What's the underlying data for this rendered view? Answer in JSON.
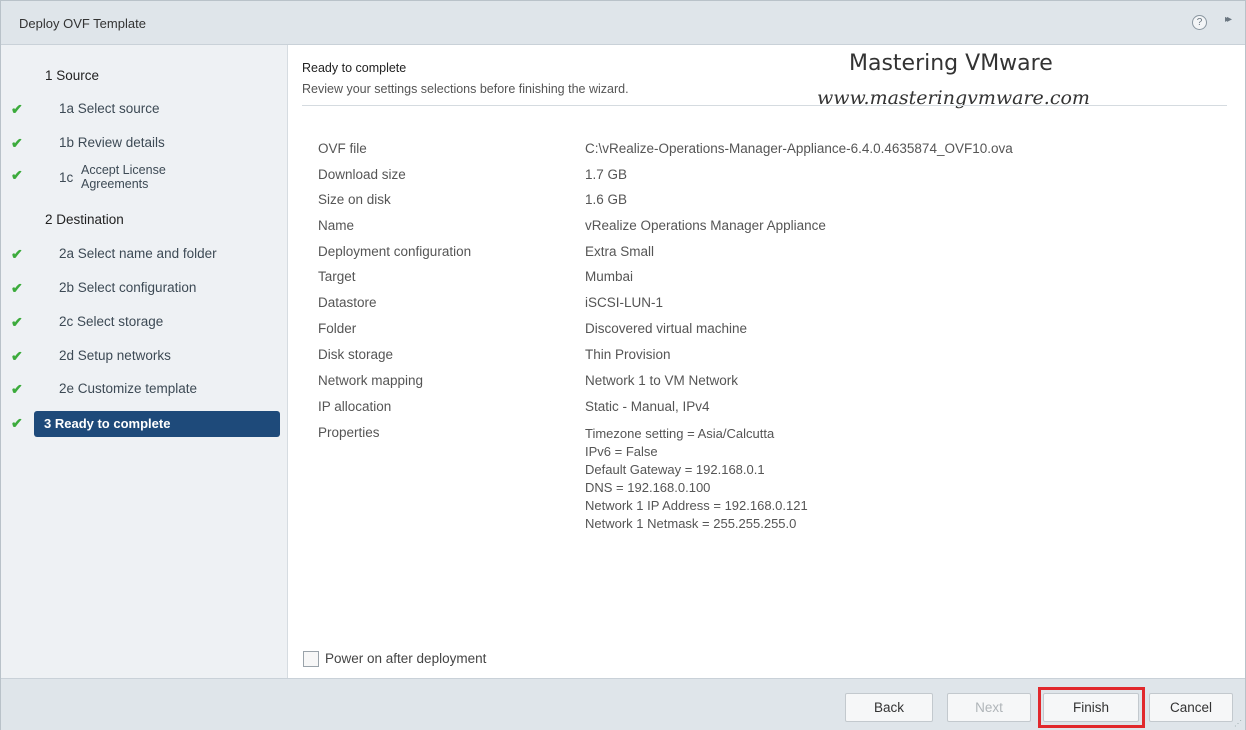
{
  "window": {
    "title": "Deploy OVF Template",
    "help_icon": "?",
    "expand_icon": "▸▸"
  },
  "sidebar": {
    "items": [
      {
        "label": "1  Source",
        "completed": false,
        "header": true
      },
      {
        "label": "1a  Select source",
        "completed": true
      },
      {
        "label": "1b  Review details",
        "completed": true
      },
      {
        "num": "1c",
        "label_line1": "Accept License",
        "label_line2": "Agreements",
        "completed": true
      },
      {
        "label": "2  Destination",
        "completed": false,
        "header": true
      },
      {
        "label": "2a  Select name and folder",
        "completed": true
      },
      {
        "label": "2b  Select configuration",
        "completed": true
      },
      {
        "label": "2c  Select storage",
        "completed": true
      },
      {
        "label": "2d  Setup networks",
        "completed": true
      },
      {
        "label": "2e  Customize template",
        "completed": true
      },
      {
        "label": "3  Ready to complete",
        "completed": true,
        "active": true
      }
    ],
    "check_glyph": "✔"
  },
  "main": {
    "title": "Ready to complete",
    "subtitle": "Review your settings selections before finishing the wizard.",
    "watermark_title": "Mastering VMware",
    "watermark_url": "www.masteringvmware.com",
    "details": [
      {
        "key": "OVF file",
        "value": "C:\\vRealize-Operations-Manager-Appliance-6.4.0.4635874_OVF10.ova"
      },
      {
        "key": "Download size",
        "value": "1.7 GB"
      },
      {
        "key": "Size on disk",
        "value": "1.6 GB"
      },
      {
        "key": "Name",
        "value": "vRealize Operations Manager Appliance"
      },
      {
        "key": "Deployment configuration",
        "value": "Extra Small"
      },
      {
        "key": "Target",
        "value": "Mumbai"
      },
      {
        "key": "Datastore",
        "value": "iSCSI-LUN-1"
      },
      {
        "key": "Folder",
        "value": "Discovered virtual machine"
      },
      {
        "key": "Disk storage",
        "value": "Thin Provision"
      },
      {
        "key": "Network mapping",
        "value": "Network 1 to VM Network"
      },
      {
        "key": "IP allocation",
        "value": "Static - Manual, IPv4"
      }
    ],
    "properties": {
      "key": "Properties",
      "values": [
        "Timezone setting = Asia/Calcutta",
        "IPv6 = False",
        "Default Gateway = 192.168.0.1",
        "DNS = 192.168.0.100",
        "Network 1 IP Address = 192.168.0.121",
        "Network 1 Netmask = 255.255.255.0"
      ]
    },
    "power_on_label": "Power on after deployment",
    "power_on_checked": false
  },
  "footer": {
    "back_label": "Back",
    "next_label": "Next",
    "finish_label": "Finish",
    "cancel_label": "Cancel"
  },
  "colors": {
    "check_green": "#3cab3c",
    "active_step_bg": "#1e4a7a",
    "highlight_red": "#e1282c"
  }
}
